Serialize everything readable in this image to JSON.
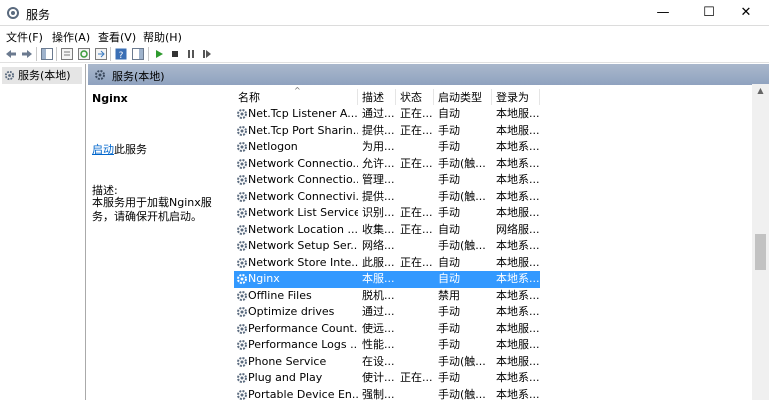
{
  "window": {
    "title": "服务",
    "min": "—",
    "max": "☐",
    "close": "✕"
  },
  "menu": [
    "文件(F)",
    "操作(A)",
    "查看(V)",
    "帮助(H)"
  ],
  "toolbar_icons": [
    "back-icon",
    "forward-icon",
    "show-tree-icon",
    "properties-icon",
    "refresh-icon",
    "export-icon",
    "help-icon",
    "console-icon",
    "start-icon",
    "stop-icon",
    "pause-icon"
  ],
  "tree": {
    "item": "服务(本地)"
  },
  "main": {
    "header": "服务(本地)"
  },
  "detail": {
    "service_name": "Nginx",
    "start_link": "启动",
    "start_suffix": "此服务",
    "desc_label": "描述:",
    "desc_text": "本服务用于加载Nginx服务，请确保开机启动。"
  },
  "columns": {
    "name": "名称",
    "desc": "描述",
    "state": "状态",
    "type": "启动类型",
    "logon": "登录为"
  },
  "rows": [
    {
      "name": "Net.Tcp Listener A...",
      "desc": "通过...",
      "state": "正在...",
      "type": "自动",
      "logon": "本地服..."
    },
    {
      "name": "Net.Tcp Port Sharin...",
      "desc": "提供...",
      "state": "正在...",
      "type": "手动",
      "logon": "本地服..."
    },
    {
      "name": "Netlogon",
      "desc": "为用...",
      "state": "",
      "type": "手动",
      "logon": "本地系..."
    },
    {
      "name": "Network Connectio...",
      "desc": "允许...",
      "state": "正在...",
      "type": "手动(触...",
      "logon": "本地系..."
    },
    {
      "name": "Network Connectio...",
      "desc": "管理...",
      "state": "",
      "type": "手动",
      "logon": "本地系..."
    },
    {
      "name": "Network Connectivi...",
      "desc": "提供...",
      "state": "",
      "type": "手动(触...",
      "logon": "本地系..."
    },
    {
      "name": "Network List Service",
      "desc": "识别...",
      "state": "正在...",
      "type": "手动",
      "logon": "本地服..."
    },
    {
      "name": "Network Location ...",
      "desc": "收集...",
      "state": "正在...",
      "type": "自动",
      "logon": "网络服..."
    },
    {
      "name": "Network Setup Ser...",
      "desc": "网络...",
      "state": "",
      "type": "手动(触...",
      "logon": "本地系..."
    },
    {
      "name": "Network Store Inte...",
      "desc": "此服...",
      "state": "正在...",
      "type": "自动",
      "logon": "本地服..."
    },
    {
      "name": "Nginx",
      "desc": "本服...",
      "state": "",
      "type": "自动",
      "logon": "本地系...",
      "selected": true
    },
    {
      "name": "Offline Files",
      "desc": "脱机...",
      "state": "",
      "type": "禁用",
      "logon": "本地系..."
    },
    {
      "name": "Optimize drives",
      "desc": "通过...",
      "state": "",
      "type": "手动",
      "logon": "本地系..."
    },
    {
      "name": "Performance Count...",
      "desc": "使远...",
      "state": "",
      "type": "手动",
      "logon": "本地服..."
    },
    {
      "name": "Performance Logs ...",
      "desc": "性能...",
      "state": "",
      "type": "手动",
      "logon": "本地服..."
    },
    {
      "name": "Phone Service",
      "desc": "在设...",
      "state": "",
      "type": "手动(触...",
      "logon": "本地服..."
    },
    {
      "name": "Plug and Play",
      "desc": "使计...",
      "state": "正在...",
      "type": "手动",
      "logon": "本地系..."
    },
    {
      "name": "Portable Device En...",
      "desc": "强制...",
      "state": "",
      "type": "手动(触...",
      "logon": "本地系..."
    }
  ]
}
